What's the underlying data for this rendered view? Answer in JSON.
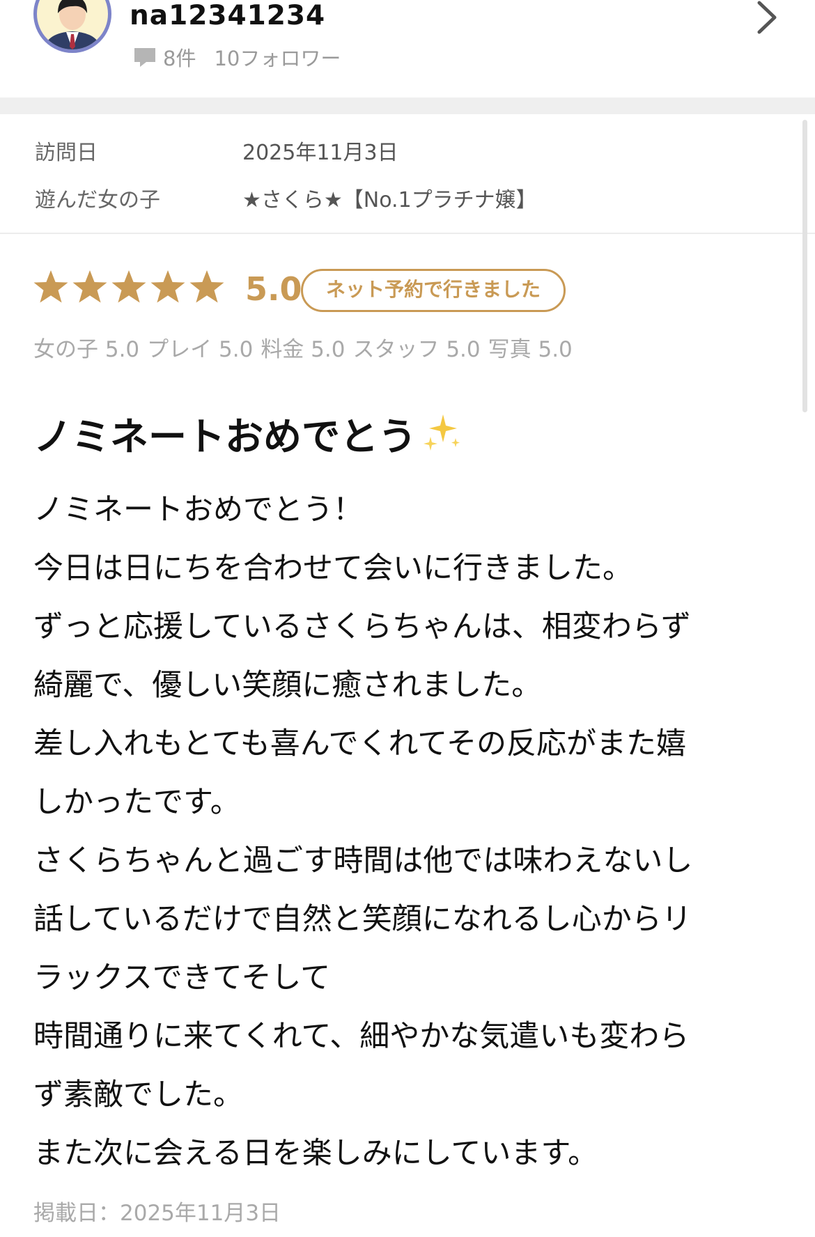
{
  "reviewer": {
    "name": "na12341234",
    "review_count": "8件",
    "followers": "10フォロワー"
  },
  "visit": {
    "date_label": "訪問日",
    "date_value": "2025年11月3日",
    "girl_label": "遊んだ女の子",
    "girl_value": "★さくら★【No.1プラチナ嬢】"
  },
  "rating": {
    "stars": 5,
    "score": "5.0",
    "badge": "ネット予約で行きました",
    "subscores": [
      "女の子 5.0",
      "プレイ 5.0",
      "料金 5.0",
      "スタッフ 5.0",
      "写真 5.0"
    ],
    "color": "#c99a55"
  },
  "review": {
    "title": "ノミネートおめでとう",
    "title_icon": "sparkles-icon",
    "lines": [
      "ノミネートおめでとう！",
      "今日は日にちを合わせて会いに行きました。",
      "ずっと応援しているさくらちゃんは、相変わらず",
      "綺麗で、優しい笑顔に癒されました。",
      "差し入れもとても喜んでくれてその反応がまた嬉",
      "しかったです。",
      "さくらちゃんと過ごす時間は他では味わえないし",
      "話しているだけで自然と笑顔になれるし心からリ",
      "ラックスできてそして",
      "時間通りに来てくれて、細やかな気遣いも変わら",
      "ず素敵でした。",
      "また次に会える日を楽しみにしています。"
    ],
    "posted": "掲載日：2025年11月3日"
  }
}
